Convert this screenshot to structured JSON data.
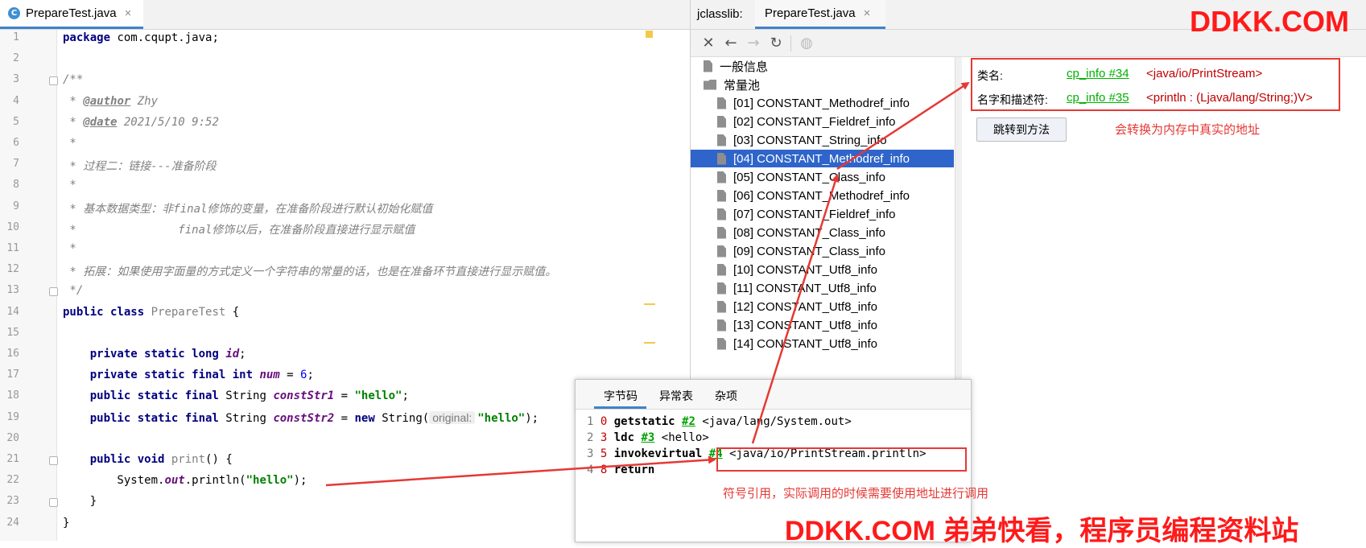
{
  "editor": {
    "tab": {
      "icon_letter": "C",
      "title": "PrepareTest.java",
      "close": "×"
    },
    "lines": [
      {
        "n": "1",
        "tokens": [
          {
            "t": "package",
            "c": "kw"
          },
          {
            "t": " com.cqupt.java;",
            "c": ""
          }
        ]
      },
      {
        "n": "2",
        "tokens": []
      },
      {
        "n": "3",
        "tokens": [
          {
            "t": "/**",
            "c": "cm"
          }
        ]
      },
      {
        "n": "4",
        "tokens": [
          {
            "t": " * ",
            "c": "cm"
          },
          {
            "t": "@author",
            "c": "tag"
          },
          {
            "t": " Zhy",
            "c": "cm"
          }
        ]
      },
      {
        "n": "5",
        "tokens": [
          {
            "t": " * ",
            "c": "cm"
          },
          {
            "t": "@date",
            "c": "tag"
          },
          {
            "t": " 2021/5/10 9:52",
            "c": "cm"
          }
        ]
      },
      {
        "n": "6",
        "tokens": [
          {
            "t": " *",
            "c": "cm"
          }
        ]
      },
      {
        "n": "7",
        "tokens": [
          {
            "t": " * 过程二：链接---准备阶段",
            "c": "cm"
          }
        ]
      },
      {
        "n": "8",
        "tokens": [
          {
            "t": " *",
            "c": "cm"
          }
        ]
      },
      {
        "n": "9",
        "tokens": [
          {
            "t": " * 基本数据类型：非final修饰的变量，在准备阶段进行默认初始化赋值",
            "c": "cm"
          }
        ]
      },
      {
        "n": "10",
        "tokens": [
          {
            "t": " *               final修饰以后，在准备阶段直接进行显示赋值",
            "c": "cm"
          }
        ]
      },
      {
        "n": "11",
        "tokens": [
          {
            "t": " *",
            "c": "cm"
          }
        ]
      },
      {
        "n": "12",
        "tokens": [
          {
            "t": " * 拓展：如果使用字面量的方式定义一个字符串的常量的话，也是在准备环节直接进行显示赋值。",
            "c": "cm"
          }
        ]
      },
      {
        "n": "13",
        "tokens": [
          {
            "t": " */",
            "c": "cm"
          }
        ]
      },
      {
        "n": "14",
        "tokens": [
          {
            "t": "public class",
            "c": "kw"
          },
          {
            "t": " ",
            "c": ""
          },
          {
            "t": "PrepareTest",
            "c": "gry"
          },
          {
            "t": " {",
            "c": ""
          }
        ]
      },
      {
        "n": "15",
        "tokens": []
      },
      {
        "n": "16",
        "tokens": [
          {
            "t": "    ",
            "c": ""
          },
          {
            "t": "private static long",
            "c": "kw"
          },
          {
            "t": " ",
            "c": ""
          },
          {
            "t": "id",
            "c": "fld"
          },
          {
            "t": ";",
            "c": ""
          }
        ]
      },
      {
        "n": "17",
        "tokens": [
          {
            "t": "    ",
            "c": ""
          },
          {
            "t": "private static final int",
            "c": "kw"
          },
          {
            "t": " ",
            "c": ""
          },
          {
            "t": "num",
            "c": "fld"
          },
          {
            "t": " = ",
            "c": ""
          },
          {
            "t": "6",
            "c": "num"
          },
          {
            "t": ";",
            "c": ""
          }
        ]
      },
      {
        "n": "18",
        "tokens": [
          {
            "t": "    ",
            "c": ""
          },
          {
            "t": "public static final",
            "c": "kw"
          },
          {
            "t": " String ",
            "c": ""
          },
          {
            "t": "constStr1",
            "c": "fld"
          },
          {
            "t": " = ",
            "c": ""
          },
          {
            "t": "\"hello\"",
            "c": "str"
          },
          {
            "t": ";",
            "c": ""
          }
        ]
      },
      {
        "n": "19",
        "tokens": [
          {
            "t": "    ",
            "c": ""
          },
          {
            "t": "public static final",
            "c": "kw"
          },
          {
            "t": " String ",
            "c": ""
          },
          {
            "t": "constStr2",
            "c": "fld"
          },
          {
            "t": " = ",
            "c": ""
          },
          {
            "t": "new",
            "c": "kw"
          },
          {
            "t": " String(",
            "c": ""
          },
          {
            "t": "original:",
            "c": "hint"
          },
          {
            "t": "\"hello\"",
            "c": "str"
          },
          {
            "t": ");",
            "c": ""
          }
        ]
      },
      {
        "n": "20",
        "tokens": []
      },
      {
        "n": "21",
        "tokens": [
          {
            "t": "    ",
            "c": ""
          },
          {
            "t": "public void",
            "c": "kw"
          },
          {
            "t": " ",
            "c": ""
          },
          {
            "t": "print",
            "c": "gry"
          },
          {
            "t": "() {",
            "c": ""
          }
        ]
      },
      {
        "n": "22",
        "tokens": [
          {
            "t": "        System.",
            "c": ""
          },
          {
            "t": "out",
            "c": "fld"
          },
          {
            "t": ".println(",
            "c": ""
          },
          {
            "t": "\"hello\"",
            "c": "str"
          },
          {
            "t": ");",
            "c": ""
          }
        ]
      },
      {
        "n": "23",
        "tokens": [
          {
            "t": "    }",
            "c": ""
          }
        ]
      },
      {
        "n": "24",
        "tokens": [
          {
            "t": "}",
            "c": ""
          }
        ]
      }
    ]
  },
  "jclasslib": {
    "title": "jclasslib:",
    "tab": {
      "title": "PrepareTest.java",
      "close": "×"
    },
    "toolbar": [
      {
        "name": "close-icon",
        "glyph": "✕",
        "enabled": true
      },
      {
        "name": "back-icon",
        "glyph": "←",
        "enabled": true
      },
      {
        "name": "forward-icon",
        "glyph": "→",
        "enabled": false
      },
      {
        "name": "refresh-icon",
        "glyph": "↻",
        "enabled": true
      },
      {
        "name": "web-icon",
        "glyph": "◍",
        "enabled": false
      }
    ],
    "tree": {
      "general_info": "一般信息",
      "constant_pool": "常量池",
      "items": [
        "[01] CONSTANT_Methodref_info",
        "[02] CONSTANT_Fieldref_info",
        "[03] CONSTANT_String_info",
        "[04] CONSTANT_Methodref_info",
        "[05] CONSTANT_Class_info",
        "[06] CONSTANT_Methodref_info",
        "[07] CONSTANT_Fieldref_info",
        "[08] CONSTANT_Class_info",
        "[09] CONSTANT_Class_info",
        "[10] CONSTANT_Utf8_info",
        "[11] CONSTANT_Utf8_info",
        "[12] CONSTANT_Utf8_info",
        "[13] CONSTANT_Utf8_info",
        "[14] CONSTANT_Utf8_info"
      ],
      "selected_index": 3
    },
    "detail": {
      "class_name_label": "类名:",
      "class_name_link": "cp_info #34",
      "class_name_value": "<java/io/PrintStream>",
      "name_type_label": "名字和描述符:",
      "name_type_link": "cp_info #35",
      "name_type_value": "<println : (Ljava/lang/String;)V>",
      "goto_button": "跳转到方法"
    }
  },
  "popup": {
    "tabs": [
      "字节码",
      "异常表",
      "杂项"
    ],
    "active_tab": 0,
    "bytecode": [
      {
        "line": "1",
        "offset": "0",
        "op": "getstatic",
        "ref": "#2",
        "arg": "<java/lang/System.out>"
      },
      {
        "line": "2",
        "offset": "3",
        "op": "ldc",
        "ref": "#3",
        "arg": "<hello>"
      },
      {
        "line": "3",
        "offset": "5",
        "op": "invokevirtual",
        "ref": "#4",
        "arg": "<java/io/PrintStream.println>"
      },
      {
        "line": "4",
        "offset": "8",
        "op": "return",
        "ref": "",
        "arg": ""
      }
    ]
  },
  "annotations": {
    "real_address": "会转换为内存中真实的地址",
    "symbol_ref": "符号引用，实际调用的时候需要使用地址进行调用"
  },
  "watermarks": {
    "top": "DDKK.COM",
    "bottom": "DDKK.COM 弟弟快看，程序员编程资料站"
  },
  "colors": {
    "annotation_red": "#e53935",
    "selection_blue": "#2f65ca",
    "cp_link_green": "#00b200",
    "tab_underline": "#4083c9"
  }
}
